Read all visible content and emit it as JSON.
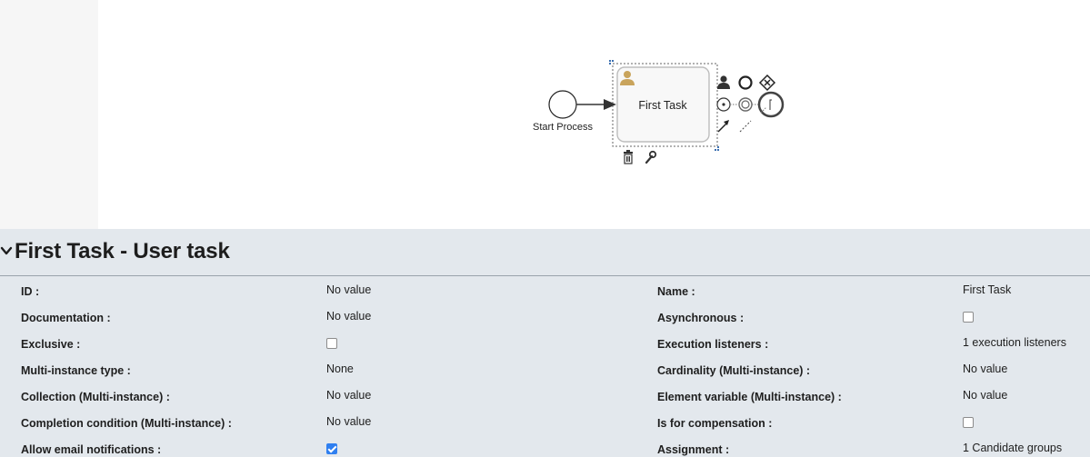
{
  "diagram": {
    "start_event_label": "Start Process",
    "task_label": "First Task"
  },
  "panel": {
    "title": "First Task - User task",
    "rows": [
      {
        "left": {
          "label": "ID :",
          "value": "No value"
        },
        "right": {
          "label": "Name :",
          "value": "First Task"
        }
      },
      {
        "left": {
          "label": "Documentation :",
          "value": "No value"
        },
        "right": {
          "label": "Asynchronous :",
          "checkbox": false
        }
      },
      {
        "left": {
          "label": "Exclusive :",
          "checkbox": false
        },
        "right": {
          "label": "Execution listeners :",
          "value": "1 execution listeners"
        }
      },
      {
        "left": {
          "label": "Multi-instance type :",
          "value": "None"
        },
        "right": {
          "label": "Cardinality (Multi-instance) :",
          "value": "No value"
        }
      },
      {
        "left": {
          "label": "Collection (Multi-instance) :",
          "value": "No value"
        },
        "right": {
          "label": "Element variable (Multi-instance) :",
          "value": "No value"
        }
      },
      {
        "left": {
          "label": "Completion condition (Multi-instance) :",
          "value": "No value"
        },
        "right": {
          "label": "Is for compensation :",
          "checkbox": false
        }
      },
      {
        "left": {
          "label": "Allow email notifications :",
          "checkbox": true
        },
        "right": {
          "label": "Assignment :",
          "value": "1 Candidate groups"
        }
      }
    ]
  },
  "colors": {
    "panel_bg": "#e3e8ed",
    "checkbox_checked": "#2f7ff0",
    "user_icon": "#c9a45c"
  }
}
